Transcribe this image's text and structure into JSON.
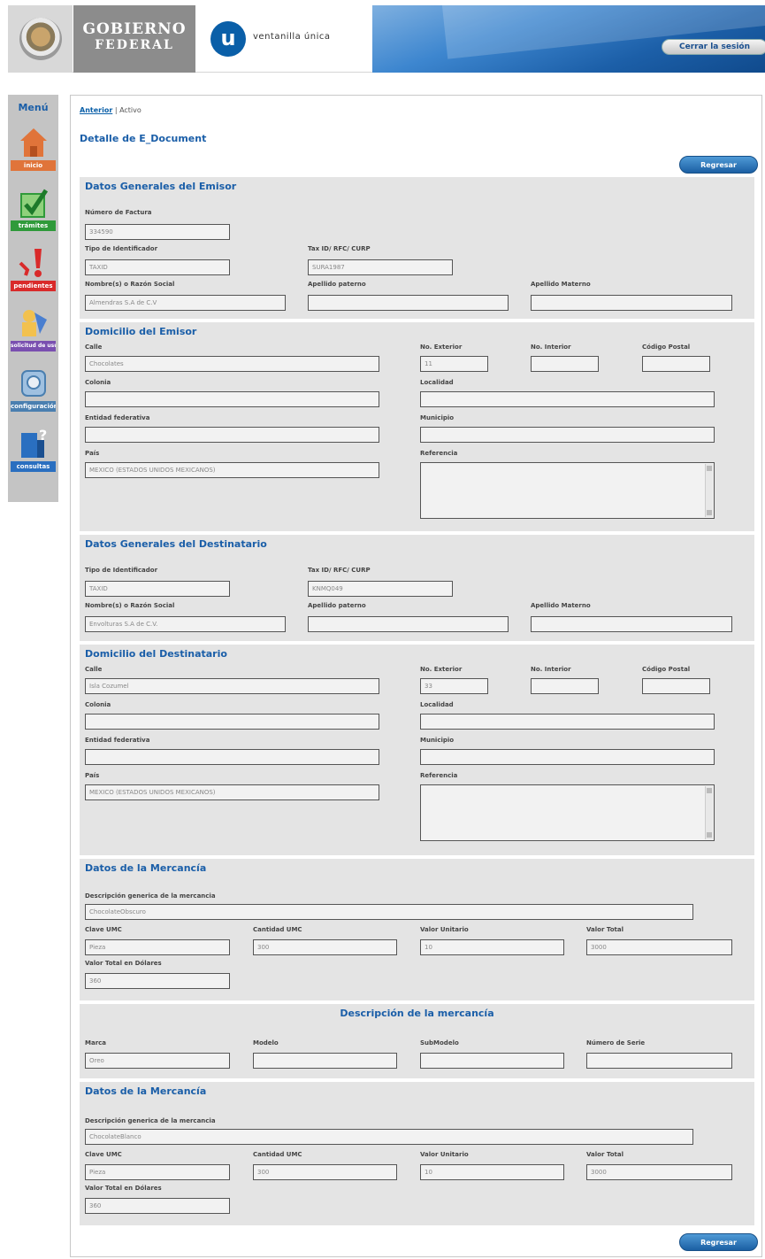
{
  "header": {
    "gobierno_line1": "Gobierno",
    "gobierno_line2": "Federal",
    "vu_letter": "u",
    "vu_text": "ventanilla única",
    "logout_label": "Cerrar la sesión"
  },
  "sidebar": {
    "title": "Menú",
    "items": [
      {
        "label": "inicio",
        "icon": "home-icon",
        "color": "#e0743a"
      },
      {
        "label": "trámites",
        "icon": "checkmark-icon",
        "color": "#2f9a3a"
      },
      {
        "label": "pendientes",
        "icon": "alert-icon",
        "color": "#d92a2a"
      },
      {
        "label": "solicitud de usuarios",
        "icon": "users-icon",
        "color": "#7a4fb0"
      },
      {
        "label": "configuración",
        "icon": "gear-icon",
        "color": "#4a7fb0"
      },
      {
        "label": "consultas",
        "icon": "help-icon",
        "color": "#2a6fc0"
      }
    ]
  },
  "breadcrumb": {
    "link": "Anterior",
    "separator": "|",
    "current": "Activo"
  },
  "page_title": "Detalle de E_Document",
  "regresar_label": "Regresar",
  "emisor": {
    "title": "Datos Generales del Emisor",
    "labels": {
      "factura": "Número de Factura",
      "tipo_id": "Tipo de Identificador",
      "tax_id": "Tax ID/ RFC/ CURP",
      "nombre": "Nombre(s) o Razón Social",
      "apellido_paterno": "Apellido paterno",
      "apellido_materno": "Apellido Materno"
    },
    "values": {
      "factura": "334590",
      "tipo_id": "TAXID",
      "tax_id": "SURA1987",
      "nombre": "Almendras S.A de C.V",
      "apellido_paterno": "",
      "apellido_materno": ""
    }
  },
  "domicilio_emisor": {
    "title": "Domicilio del Emisor",
    "labels": {
      "calle": "Calle",
      "no_ext": "No. Exterior",
      "no_int": "No. Interior",
      "cp": "Código Postal",
      "colonia": "Colonia",
      "localidad": "Localidad",
      "entidad": "Entidad federativa",
      "municipio": "Municipio",
      "pais": "País",
      "referencia": "Referencia"
    },
    "values": {
      "calle": "Chocolates",
      "no_ext": "11",
      "no_int": "",
      "cp": "",
      "colonia": "",
      "localidad": "",
      "entidad": "",
      "municipio": "",
      "pais": "MEXICO (ESTADOS UNIDOS MEXICANOS)"
    }
  },
  "destinatario": {
    "title": "Datos Generales del Destinatario",
    "labels": {
      "tipo_id": "Tipo de Identificador",
      "tax_id": "Tax ID/ RFC/ CURP",
      "nombre": "Nombre(s) o Razón Social",
      "apellido_paterno": "Apellido paterno",
      "apellido_materno": "Apellido Materno"
    },
    "values": {
      "tipo_id": "TAXID",
      "tax_id": "KNMQ049",
      "nombre": "Envolturas S.A de C.V.",
      "apellido_paterno": "",
      "apellido_materno": ""
    }
  },
  "domicilio_destinatario": {
    "title": "Domicilio del Destinatario",
    "labels": {
      "calle": "Calle",
      "no_ext": "No. Exterior",
      "no_int": "No. Interior",
      "cp": "Código Postal",
      "colonia": "Colonia",
      "localidad": "Localidad",
      "entidad": "Entidad federativa",
      "municipio": "Municipio",
      "pais": "País",
      "referencia": "Referencia"
    },
    "values": {
      "calle": "Isla Cozumel",
      "no_ext": "33",
      "no_int": "",
      "cp": "",
      "colonia": "",
      "localidad": "",
      "entidad": "",
      "municipio": "",
      "pais": "MEXICO (ESTADOS UNIDOS MEXICANOS)"
    }
  },
  "mercancia1": {
    "title": "Datos de la Mercancía",
    "labels": {
      "descripcion": "Descripción generica de la mercancia",
      "clave": "Clave UMC",
      "cantidad": "Cantidad UMC",
      "valor_unitario": "Valor Unitario",
      "valor_total": "Valor Total",
      "valor_dolares": "Valor Total en Dólares"
    },
    "values": {
      "descripcion": "ChocolateObscuro",
      "clave": "Pieza",
      "cantidad": "300",
      "valor_unitario": "10",
      "valor_total": "3000",
      "valor_dolares": "360"
    }
  },
  "descripcion_mercancia": {
    "title": "Descripción de la mercancía",
    "labels": {
      "marca": "Marca",
      "modelo": "Modelo",
      "submodelo": "SubModelo",
      "serie": "Número de Serie"
    },
    "values": {
      "marca": "Oreo",
      "modelo": "",
      "submodelo": "",
      "serie": ""
    }
  },
  "mercancia2": {
    "title": "Datos de la Mercancía",
    "labels": {
      "descripcion": "Descripción generica de la mercancia",
      "clave": "Clave UMC",
      "cantidad": "Cantidad UMC",
      "valor_unitario": "Valor Unitario",
      "valor_total": "Valor Total",
      "valor_dolares": "Valor Total en Dólares"
    },
    "values": {
      "descripcion": "ChocolateBlanco",
      "clave": "Pieza",
      "cantidad": "300",
      "valor_unitario": "10",
      "valor_total": "3000",
      "valor_dolares": "360"
    }
  }
}
